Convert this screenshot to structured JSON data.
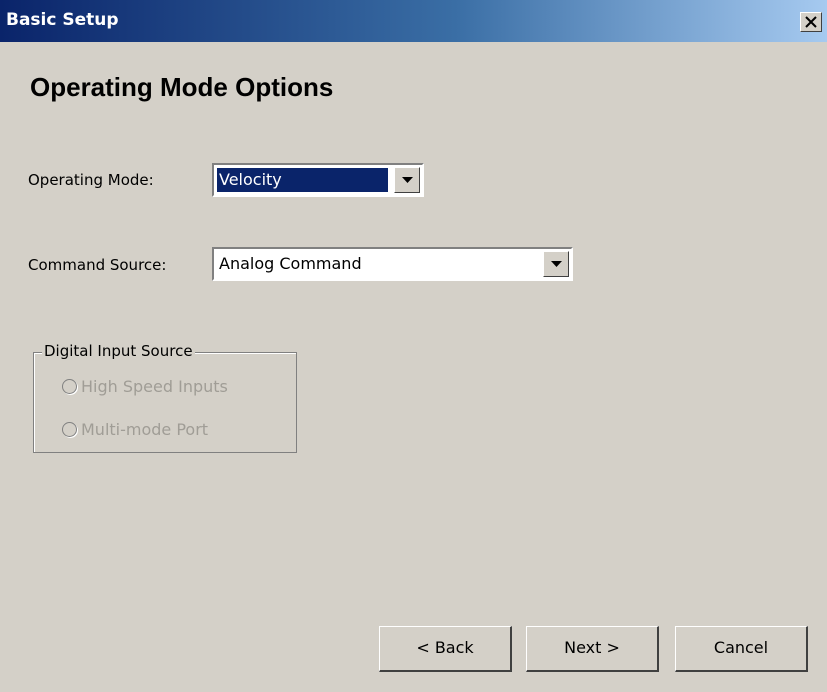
{
  "window": {
    "title": "Basic Setup",
    "close_icon": "close-icon"
  },
  "page": {
    "heading": "Operating Mode Options"
  },
  "operating_mode": {
    "label": "Operating Mode:",
    "value": "Velocity"
  },
  "command_source": {
    "label": "Command Source:",
    "value": "Analog Command"
  },
  "digital_input_source": {
    "title": "Digital Input Source",
    "options": [
      {
        "label": "High Speed Inputs",
        "enabled": false,
        "selected": false
      },
      {
        "label": "Multi-mode Port",
        "enabled": false,
        "selected": false
      }
    ]
  },
  "buttons": {
    "back": "< Back",
    "next": "Next >",
    "cancel": "Cancel"
  },
  "colors": {
    "titlebar_start": "#0a246a",
    "titlebar_end": "#a6caf0",
    "dialog_bg": "#d4d0c8",
    "selection": "#0a246a",
    "disabled_text": "#a09d96"
  }
}
